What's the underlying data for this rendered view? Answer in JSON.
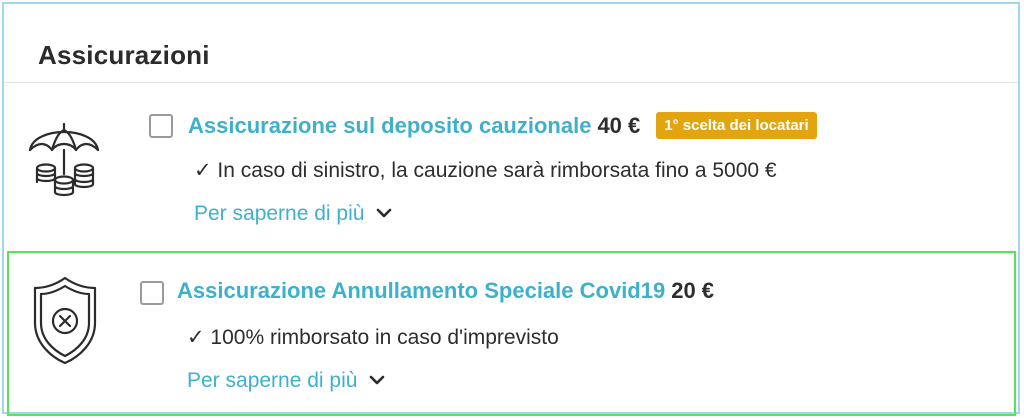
{
  "section": {
    "title": "Assicurazioni"
  },
  "items": [
    {
      "name": "Assicurazione sul deposito cauzionale",
      "price": "40 €",
      "badge": "1° scelta dei locatari",
      "description": "✓ In caso di sinistro, la cauzione sarà rimborsata fino a 5000 €",
      "more": "Per saperne di più",
      "icon": "umbrella-coins-icon",
      "checked": false
    },
    {
      "name": "Assicurazione Annullamento Speciale Covid19",
      "price": "20 €",
      "description": "✓ 100% rimborsato in caso d'imprevisto",
      "more": "Per saperne di più",
      "icon": "shield-x-icon",
      "checked": false
    }
  ],
  "colors": {
    "link": "#3fb0cc",
    "badge": "#e2a40f",
    "panel_border": "#9fd8ea",
    "highlight_border": "#53e853"
  }
}
